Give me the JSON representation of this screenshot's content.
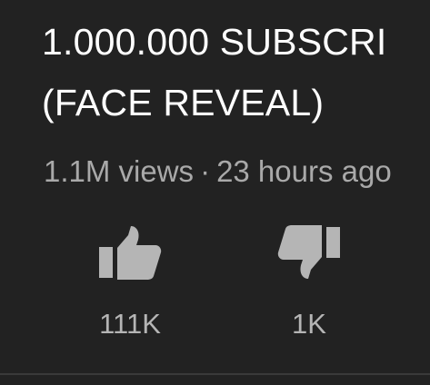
{
  "video": {
    "title_line1": "1.000.000 SUBSCRI",
    "title_line2": "(FACE REVEAL)",
    "views": "1.1M views",
    "separator": "·",
    "age": "23 hours ago"
  },
  "actions": {
    "like": {
      "icon": "thumbs-up-icon",
      "count": "111K"
    },
    "dislike": {
      "icon": "thumbs-down-icon",
      "count": "1K"
    }
  },
  "colors": {
    "background": "#222222",
    "title": "#ffffff",
    "meta": "#a9a9a9",
    "icon": "#b5b5b5"
  }
}
